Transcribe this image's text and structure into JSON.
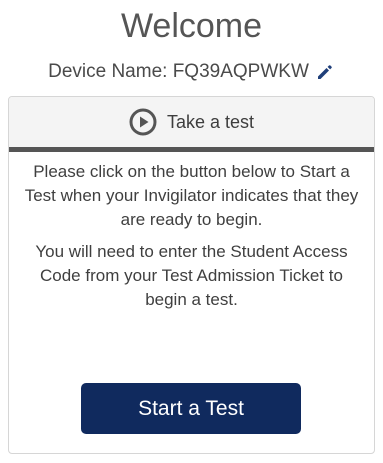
{
  "header": {
    "title": "Welcome",
    "device_label": "Device Name: FQ39AQPWKW"
  },
  "card": {
    "header_label": "Take a test",
    "instructions": [
      "Please click on the button below to Start a Test when your Invigilator indicates that they are ready to begin.",
      "You will need to enter the Student Access Code from your Test Admission Ticket to begin a test."
    ],
    "start_button_label": "Start a Test"
  },
  "icons": {
    "edit": "pencil-icon",
    "play": "play-circle-icon"
  },
  "colors": {
    "primary_button": "#102a5e",
    "pencil_icon": "#1f3f7a",
    "header_divider": "#555555"
  }
}
